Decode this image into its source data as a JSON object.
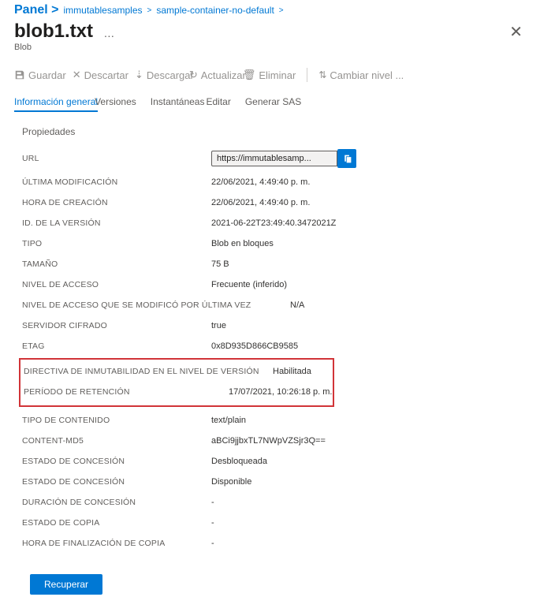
{
  "breadcrumb": {
    "panel": "Panel",
    "gt": ">",
    "items": [
      "immutablesamples",
      "sample-container-no-default"
    ]
  },
  "header": {
    "title": "blob1.txt",
    "subtitle": "Blob"
  },
  "toolbar": {
    "save": "Guardar",
    "discard": "Descartar",
    "download": "Descargar",
    "refresh": "Actualizar",
    "delete": "Eliminar",
    "changeTier": "Cambiar nivel ..."
  },
  "tabs": {
    "overview": "Información general",
    "versions": "Versiones",
    "snapshots": "Instantáneas",
    "edit": "Editar",
    "sas": "Generar SAS"
  },
  "sectionTitle": "Propiedades",
  "props": {
    "url_label": "URL",
    "url_value": "https://immutablesamp...",
    "lastmod_label": "ÚLTIMA MODIFICACIÓN",
    "lastmod_value": "22/06/2021, 4:49:40 p. m.",
    "created_label": "HORA DE CREACIÓN",
    "created_value": "22/06/2021, 4:49:40 p. m.",
    "versionid_label": "ID. DE LA VERSIÓN",
    "versionid_value": "2021-06-22T23:49:40.3472021Z",
    "type_label": "TIPO",
    "type_value": "Blob en bloques",
    "size_label": "TAMAÑO",
    "size_value": "75 B",
    "tier_label": "NIVEL DE ACCESO",
    "tier_value": "Frecuente (inferido)",
    "tiermod_label": "NIVEL DE ACCESO QUE SE MODIFICÓ POR ÚLTIMA VEZ",
    "tiermod_value": "N/A",
    "enc_label": "SERVIDOR CIFRADO",
    "enc_value": "true",
    "etag_label": "ETAG",
    "etag_value": "0x8D935D866CB9585",
    "immut_label": "DIRECTIVA DE INMUTABILIDAD EN EL NIVEL DE VERSIÓN",
    "immut_value": "Habilitada",
    "retention_label": "PERÍODO DE RETENCIÓN",
    "retention_value": "17/07/2021, 10:26:18 p. m.",
    "ctype_label": "TIPO DE CONTENIDO",
    "ctype_value": "text/plain",
    "md5_label": "CONTENT-MD5",
    "md5_value": "aBCi9jjbxTL7NWpVZSjr3Q==",
    "lease_label": "ESTADO DE CONCESIÓN",
    "lease_value": "Desbloqueada",
    "lease2_label": "ESTADO DE CONCESIÓN",
    "lease2_value": "Disponible",
    "ldur_label": "DURACIÓN DE CONCESIÓN",
    "ldur_value": "-",
    "copy_label": "ESTADO DE COPIA",
    "copy_value": "-",
    "copytime_label": "HORA DE FINALIZACIÓN DE COPIA",
    "copytime_value": "-"
  },
  "recover": "Recuperar"
}
